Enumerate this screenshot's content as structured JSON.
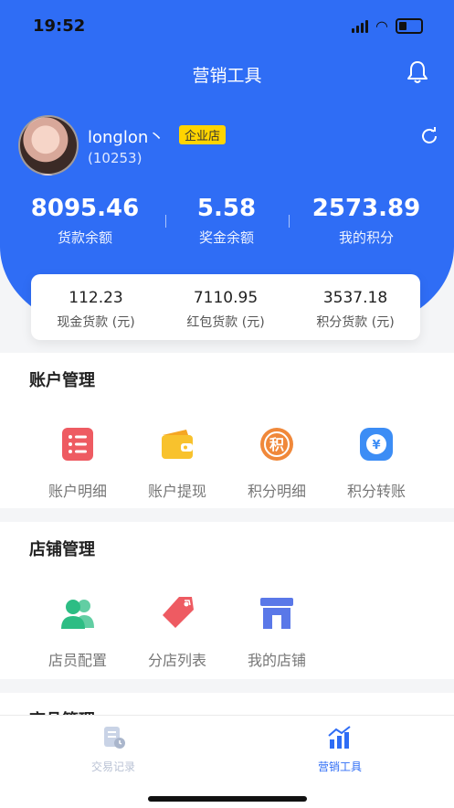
{
  "status": {
    "time": "19:52"
  },
  "topbar": {
    "title": "营销工具"
  },
  "profile": {
    "username": "longlon丶",
    "badge": "企业店",
    "uid": "(10253)"
  },
  "stats": [
    {
      "value": "8095.46",
      "label": "货款余额"
    },
    {
      "value": "5.58",
      "label": "奖金余额"
    },
    {
      "value": "2573.89",
      "label": "我的积分"
    }
  ],
  "card": [
    {
      "value": "112.23",
      "label": "现金货款 (元)"
    },
    {
      "value": "7110.95",
      "label": "红包货款 (元)"
    },
    {
      "value": "3537.18",
      "label": "积分货款 (元)"
    }
  ],
  "account": {
    "title": "账户管理",
    "items": [
      {
        "label": "账户明细",
        "icon": "list-icon",
        "color": "#ee5b62"
      },
      {
        "label": "账户提现",
        "icon": "wallet-icon",
        "color": "#f8c22d"
      },
      {
        "label": "积分明细",
        "icon": "points-icon",
        "color": "#f0883a"
      },
      {
        "label": "积分转账",
        "icon": "transfer-icon",
        "color": "#3c8df5"
      }
    ]
  },
  "store": {
    "title": "店铺管理",
    "items": [
      {
        "label": "店员配置",
        "icon": "staff-icon",
        "color": "#2dbd84"
      },
      {
        "label": "分店列表",
        "icon": "tag-icon",
        "color": "#ee5b62"
      },
      {
        "label": "我的店铺",
        "icon": "store-icon",
        "color": "#5a78e8"
      }
    ]
  },
  "goods": {
    "title": "商品管理"
  },
  "tabs": [
    {
      "label": "交易记录",
      "icon": "receipt-icon",
      "active": false
    },
    {
      "label": "营销工具",
      "icon": "chart-icon",
      "active": true
    }
  ],
  "colors": {
    "primary": "#2f6df5",
    "badge": "#ffd400"
  }
}
